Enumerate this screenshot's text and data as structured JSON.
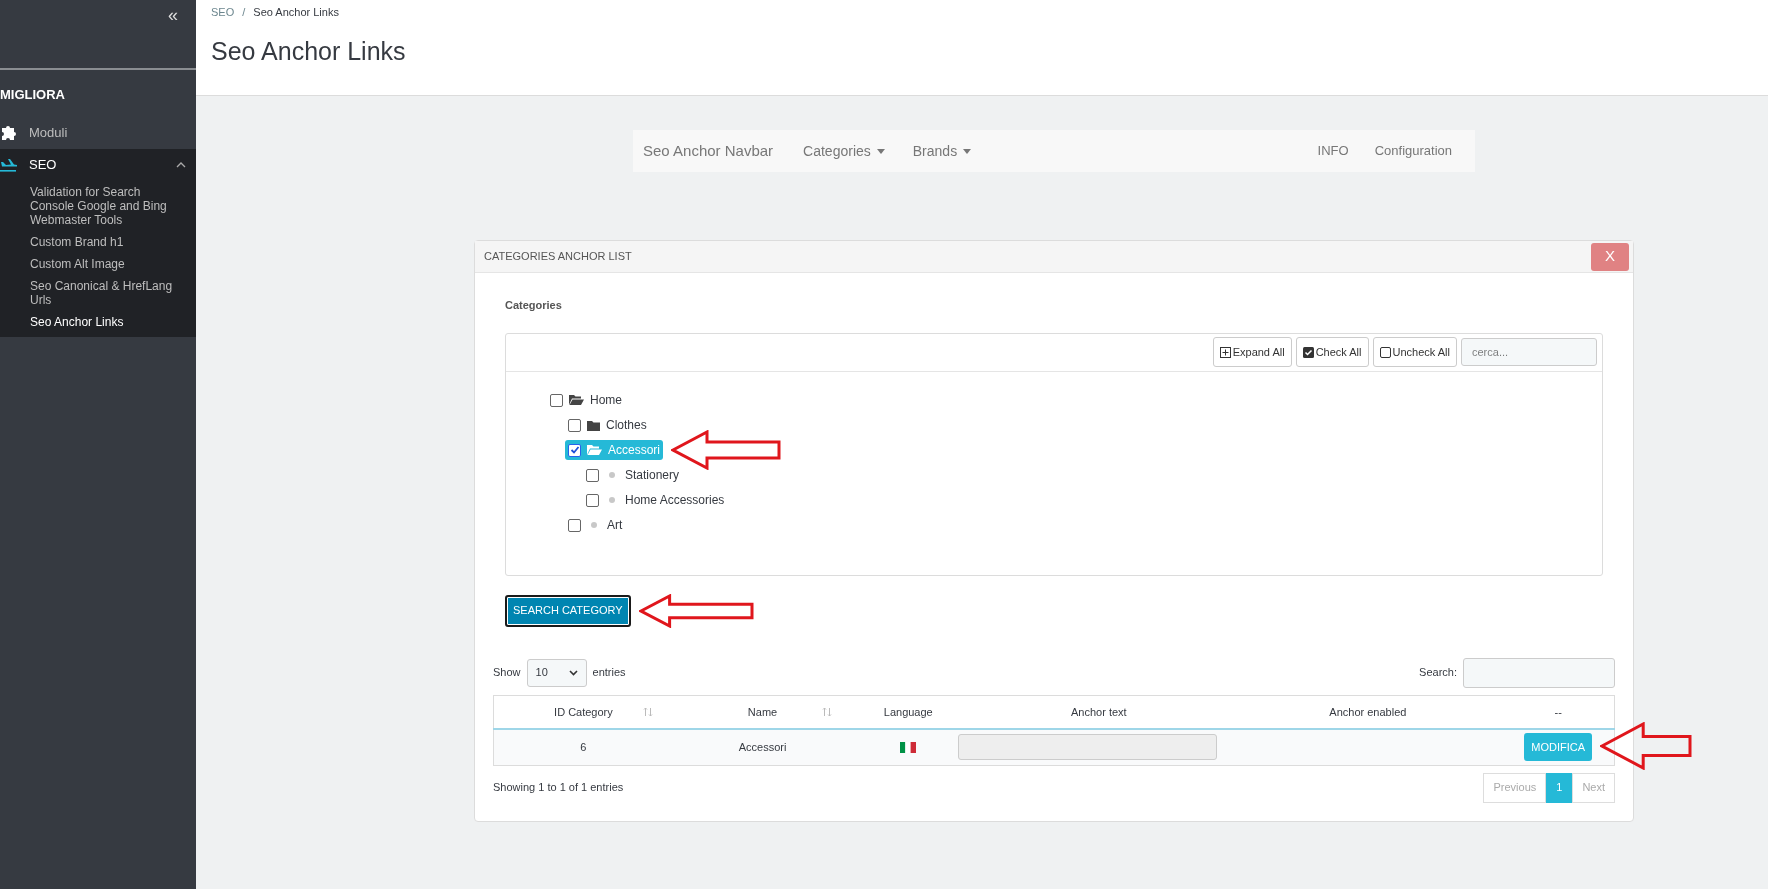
{
  "sidebar": {
    "collapse_glyph": "«",
    "section_title": "MIGLIORA",
    "items": [
      {
        "kind": "puzzle",
        "label": "Moduli",
        "selected": false,
        "expanded": false
      },
      {
        "kind": "plane",
        "label": "SEO",
        "selected": true,
        "expanded": true,
        "children": [
          {
            "label": "Validation for Search Console Google and Bing Webmaster Tools",
            "selected": false
          },
          {
            "label": "Custom Brand h1",
            "selected": false
          },
          {
            "label": "Custom Alt Image",
            "selected": false
          },
          {
            "label": "Seo Canonical & HrefLang Urls",
            "selected": false
          },
          {
            "label": "Seo Anchor Links",
            "selected": true
          }
        ]
      }
    ]
  },
  "breadcrumb": [
    "SEO",
    "Seo Anchor Links"
  ],
  "breadcrumb_separator": "/",
  "page_title": "Seo Anchor Links",
  "navbar": {
    "brand": "Seo Anchor Navbar",
    "left": [
      {
        "label": "Categories",
        "dropdown": true
      },
      {
        "label": "Brands",
        "dropdown": true
      }
    ],
    "right": [
      {
        "label": "INFO"
      },
      {
        "label": "Configuration"
      }
    ]
  },
  "panel": {
    "title": "CATEGORIES ANCHOR LIST",
    "close": "X",
    "section_label": "Categories",
    "tree_toolbar": [
      {
        "kind": "expand",
        "label": "Expand All"
      },
      {
        "kind": "check",
        "label": "Check All"
      },
      {
        "kind": "uncheck",
        "label": "Uncheck All"
      }
    ],
    "tree_search": {
      "placeholder": "cerca..."
    },
    "tree": [
      {
        "label": "Home",
        "kind": "open-folder",
        "checked": false,
        "selected": false,
        "children": [
          {
            "label": "Clothes",
            "kind": "folder",
            "checked": false,
            "selected": false
          },
          {
            "label": "Accessori",
            "kind": "open-folder",
            "checked": true,
            "selected": true,
            "annotated": true,
            "children": [
              {
                "label": "Stationery",
                "kind": "leaf",
                "checked": false,
                "selected": false
              },
              {
                "label": "Home Accessories",
                "kind": "leaf",
                "checked": false,
                "selected": false
              }
            ]
          },
          {
            "label": "Art",
            "kind": "leaf",
            "checked": false,
            "selected": false
          }
        ]
      }
    ],
    "search_button": {
      "label": "SEARCH CATEGORY",
      "annotated": true
    },
    "length": {
      "show": "Show",
      "value": "10",
      "entries": "entries"
    },
    "search": {
      "label": "Search:"
    },
    "table": {
      "columns": [
        {
          "label": "ID Category",
          "sortable": true
        },
        {
          "label": "Name",
          "sortable": true
        },
        {
          "label": "Language",
          "sortable": false
        },
        {
          "label": "Anchor text",
          "sortable": false
        },
        {
          "label": "Anchor enabled",
          "sortable": false
        },
        {
          "label": "--",
          "sortable": false
        }
      ],
      "rows": [
        {
          "id": "6",
          "name": "Accessori",
          "action": "MODIFICA",
          "annotated": true
        }
      ]
    },
    "info": "Showing 1 to 1 of 1 entries",
    "pagination": [
      {
        "label": "Previous",
        "selected": false,
        "disabled": true
      },
      {
        "label": "1",
        "selected": true,
        "disabled": false
      },
      {
        "label": "Next",
        "selected": false,
        "disabled": true
      }
    ]
  }
}
